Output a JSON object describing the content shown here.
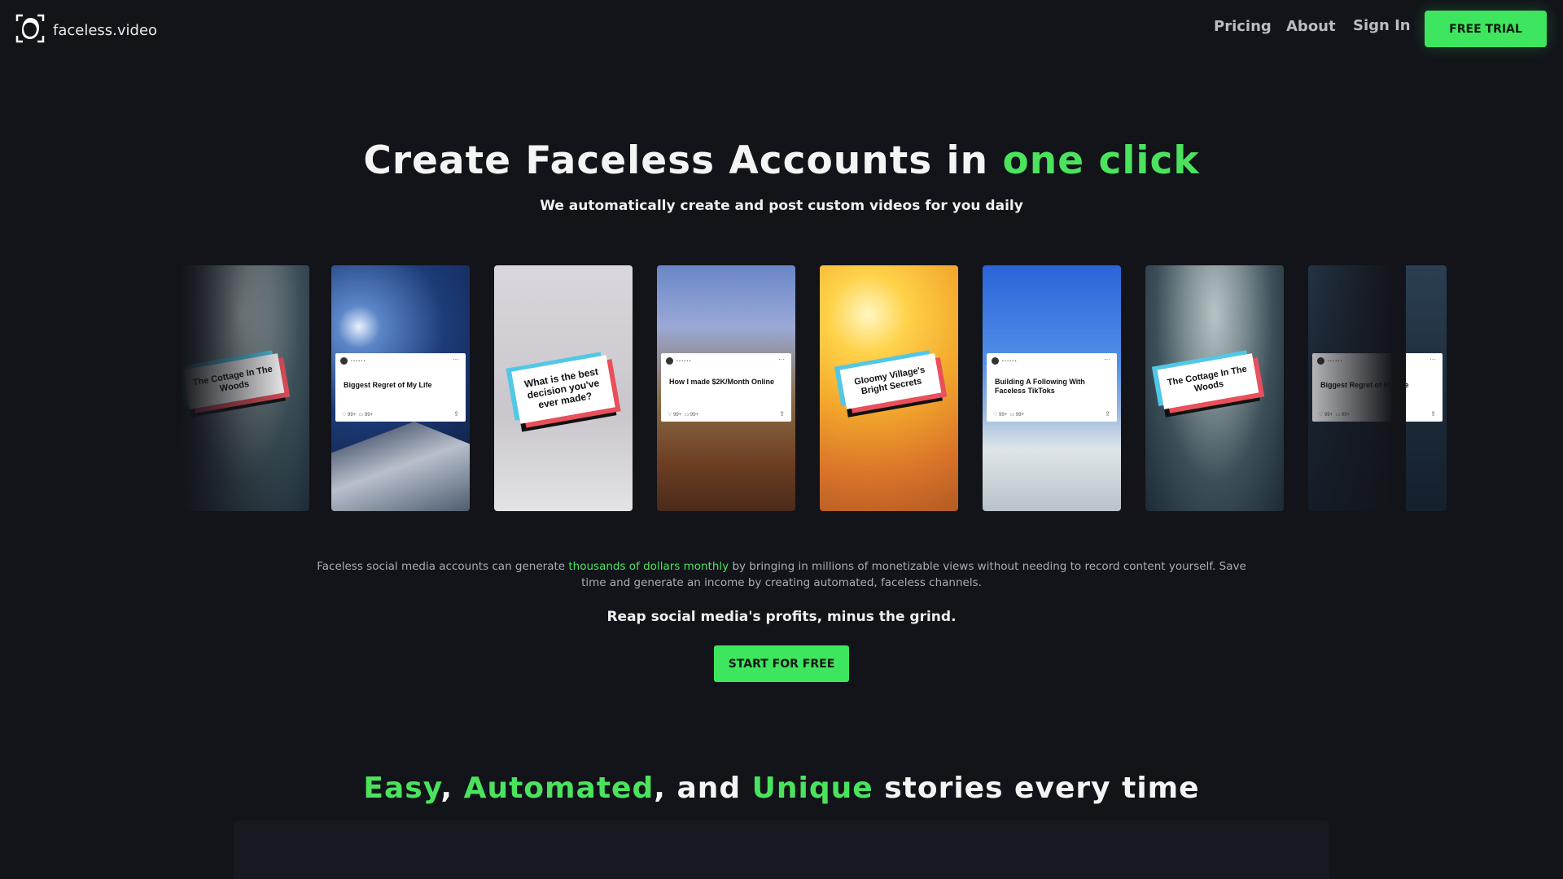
{
  "brand": {
    "name": "faceless.video",
    "logo_icon": "face-frame-icon"
  },
  "nav": {
    "pricing": "Pricing",
    "about": "About",
    "sign_in": "Sign In",
    "free_trial": "FREE TRIAL"
  },
  "hero": {
    "title_prefix": "Create Faceless Accounts in ",
    "title_highlight": "one click",
    "subtitle": "We automatically create and post custom videos for you daily"
  },
  "carousel": {
    "cards": [
      {
        "style": "tilt",
        "text": "The Cottage In The Woods",
        "background": "forest"
      },
      {
        "style": "post",
        "text": "Biggest Regret of My Life",
        "background": "space"
      },
      {
        "style": "tilt",
        "text": "What is the best decision you've ever made?",
        "background": "white"
      },
      {
        "style": "post",
        "text": "How I made $2K/Month Online",
        "background": "minecraft"
      },
      {
        "style": "tilt",
        "text": "Gloomy Village's Bright Secrets",
        "background": "sunset"
      },
      {
        "style": "post",
        "text": "Building A Following With Faceless TikToks",
        "background": "road"
      },
      {
        "style": "tilt",
        "text": "The Cottage In The Woods",
        "background": "forest"
      },
      {
        "style": "post",
        "text": "Biggest Regret of My Life",
        "background": "dark"
      }
    ],
    "post_stats": {
      "likes": "99+",
      "comments": "99+"
    }
  },
  "description": {
    "before": "Faceless social media accounts can generate ",
    "highlight": "thousands of dollars monthly",
    "after": " by bringing in millions of monetizable views without needing to record content yourself. Save time and generate an income by creating automated, faceless channels."
  },
  "tagline": "Reap social media's profits, minus the grind.",
  "cta": {
    "start": "START FOR FREE"
  },
  "section": {
    "word1": "Easy",
    "sep1": ", ",
    "word2": "Automated",
    "sep2": ", and ",
    "word3": "Unique",
    "rest": " stories every time"
  },
  "colors": {
    "background": "#12141a",
    "accent": "#3ee55e",
    "text_muted": "#a9acb2"
  }
}
